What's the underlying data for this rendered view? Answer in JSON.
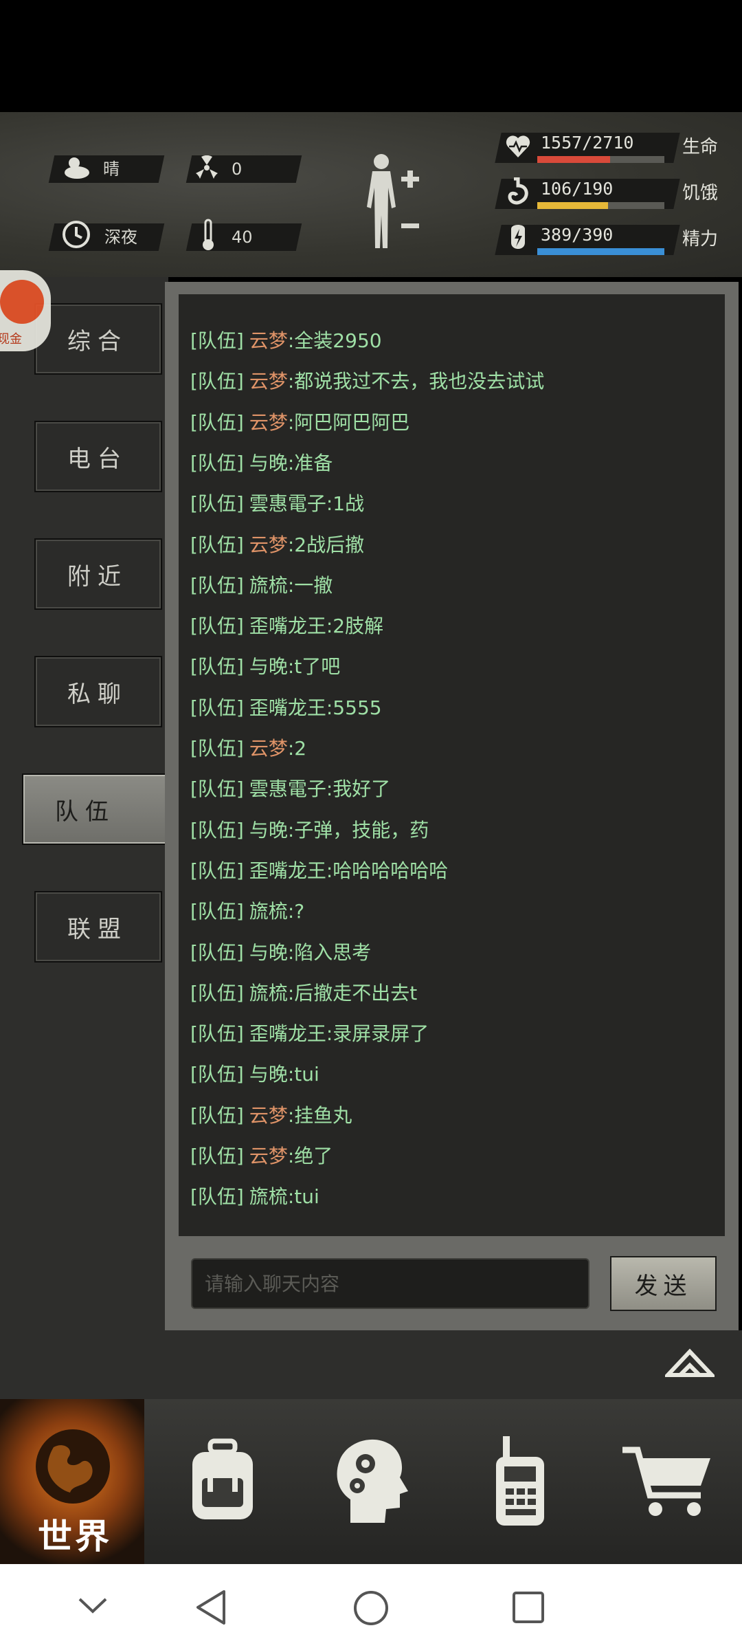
{
  "status": {
    "weather": "晴",
    "radiation": "0",
    "time_of_day": "深夜",
    "temperature": "40"
  },
  "vitals": [
    {
      "value": "1557/2710",
      "label": "生命",
      "fill": 0.5746,
      "color": "#d94a3a",
      "icon": "heart-icon"
    },
    {
      "value": "106/190",
      "label": "饥饿",
      "fill": 0.5579,
      "color": "#e6b838",
      "icon": "stomach-icon"
    },
    {
      "value": "389/390",
      "label": "精力",
      "fill": 0.9974,
      "color": "#3a8fd6",
      "icon": "energy-icon"
    }
  ],
  "badge_text": "现金",
  "tabs": [
    {
      "label": "综合"
    },
    {
      "label": "电台"
    },
    {
      "label": "附近"
    },
    {
      "label": "私聊"
    },
    {
      "label": "队伍",
      "active": true
    },
    {
      "label": "联盟"
    }
  ],
  "chat": {
    "prefix": "[队伍]",
    "messages": [
      {
        "sender": "云梦",
        "text": ":全装2950",
        "orange": true
      },
      {
        "sender": "云梦",
        "text": ":都说我过不去，我也没去试试",
        "orange": true
      },
      {
        "sender": "云梦",
        "text": ":阿巴阿巴阿巴",
        "orange": true
      },
      {
        "sender": "与晚",
        "text": ":准备",
        "orange": false
      },
      {
        "sender": "雲惠電子",
        "text": ":1战",
        "orange": false
      },
      {
        "sender": "云梦",
        "text": ":2战后撤",
        "orange": true
      },
      {
        "sender": "旒梳",
        "text": ":一撤",
        "orange": false
      },
      {
        "sender": "歪嘴龙王",
        "text": ":2肢解",
        "orange": false
      },
      {
        "sender": "与晚",
        "text": ":t了吧",
        "orange": false
      },
      {
        "sender": "歪嘴龙王",
        "text": ":5555",
        "orange": false
      },
      {
        "sender": "云梦",
        "text": ":2",
        "orange": true
      },
      {
        "sender": "雲惠電子",
        "text": ":我好了",
        "orange": false
      },
      {
        "sender": "与晚",
        "text": ":子弹，技能，药",
        "orange": false
      },
      {
        "sender": "歪嘴龙王",
        "text": ":哈哈哈哈哈哈",
        "orange": false
      },
      {
        "sender": "旒梳",
        "text": ":?",
        "orange": false
      },
      {
        "sender": "与晚",
        "text": ":陷入思考",
        "orange": false
      },
      {
        "sender": "旒梳",
        "text": ":后撤走不出去t",
        "orange": false
      },
      {
        "sender": "歪嘴龙王",
        "text": ":录屏录屏了",
        "orange": false
      },
      {
        "sender": "与晚",
        "text": ":tui",
        "orange": false
      },
      {
        "sender": "云梦",
        "text": ":挂鱼丸",
        "orange": true
      },
      {
        "sender": "云梦",
        "text": ":绝了",
        "orange": true
      },
      {
        "sender": "旒梳",
        "text": ":tui",
        "orange": false
      }
    ],
    "input_placeholder": "请输入聊天内容",
    "send_label": "发送"
  },
  "bottom_nav": {
    "world_label": "世界",
    "items": [
      "world-globe-icon",
      "backpack-icon",
      "brain-skills-icon",
      "walkie-talkie-icon",
      "shopping-cart-icon"
    ]
  },
  "colors": {
    "chat_text": "#9fe0a6",
    "chat_sender_highlight": "#e09468",
    "world_glow": "#d8761e"
  }
}
